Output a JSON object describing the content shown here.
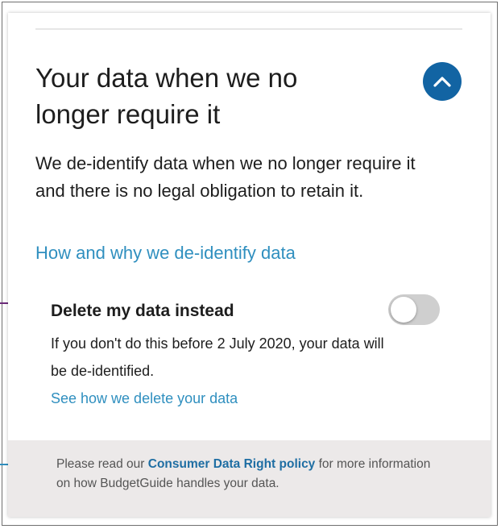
{
  "section": {
    "title": "Your data when we no longer require it",
    "body": "We de-identify data when we no longer require it and there is no legal obligation to retain it.",
    "link_label": "How and why we de-identify data",
    "expanded": true,
    "chevron_icon": "chevron-up-icon",
    "accent_color": "#1264a3",
    "link_color": "#2f8fbf"
  },
  "delete_option": {
    "label": "Delete my data instead",
    "toggle_on": false,
    "description": "If you don't do this before 2 July 2020, your data will be de-identified.",
    "link_label": "See how we delete your data"
  },
  "footer": {
    "text_before": "Please read our ",
    "link_label": "Consumer Data Right policy",
    "text_after": " for more information on how BudgetGuide handles your data."
  },
  "annotations": {
    "arrow_colors": [
      "#6b2a7a",
      "#2f8fbf"
    ]
  }
}
